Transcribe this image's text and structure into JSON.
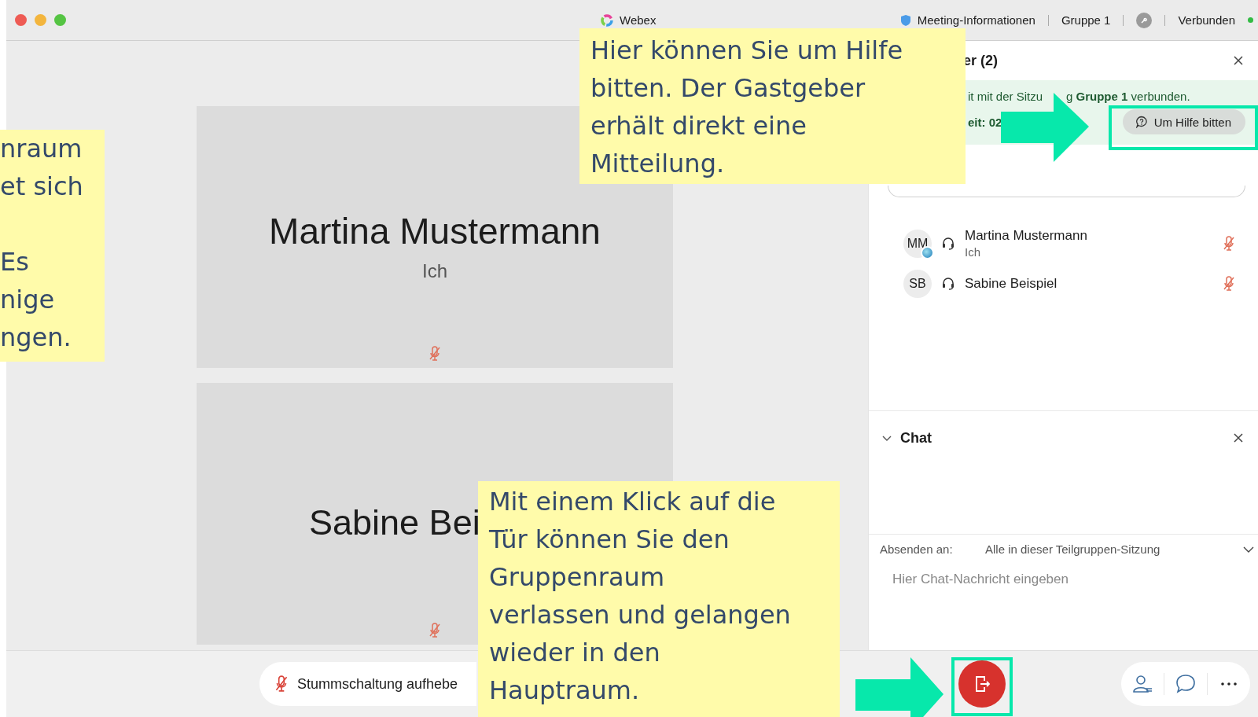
{
  "window": {
    "title": "Webex",
    "meeting_info": "Meeting-Informationen",
    "session": "Gruppe 1",
    "status": "Verbunden",
    "connected": true
  },
  "video_tiles": [
    {
      "name": "Martina Mustermann",
      "subtitle": "Ich",
      "muted": true
    },
    {
      "name": "Sabine Bei",
      "muted": true
    }
  ],
  "participants_panel": {
    "title": "er (2)",
    "banner": {
      "line_1_start": "it mit der Sitzu",
      "line_1_end": "g **Gruppe 1** verbunden.",
      "line_2": "eit: 02"
    },
    "help_button": "Um Hilfe bitten",
    "participants": [
      {
        "initials": "MM",
        "name": "Martina Mustermann",
        "subtitle": "Ich",
        "muted": true,
        "presence": true
      },
      {
        "initials": "SB",
        "name": "Sabine Beispiel",
        "muted": true,
        "presence": false
      }
    ]
  },
  "chat": {
    "title": "Chat",
    "expanded": true,
    "send_to_label": "Absenden an:",
    "send_to_value": "Alle in dieser Teilgruppen-Sitzung",
    "message": {
      "placeholder": "Hier Chat-Nachricht eingeben"
    }
  },
  "controls": {
    "unmute_button": "Stummschaltung aufhebe"
  },
  "callouts": [
    {
      "paragraphs": [
        [
          "nraum",
          "et sich"
        ],
        [
          "Es",
          "nige",
          "ngen."
        ]
      ]
    },
    {
      "paragraphs": [
        [
          "Hier können Sie um Hilfe",
          "bitten. Der Gastgeber",
          "erhält direkt eine",
          "Mitteilung."
        ]
      ]
    },
    {
      "paragraphs": [
        [
          "Mit einem Klick auf die",
          "Tür können Sie den",
          "Gruppenraum",
          "verlassen und gelangen",
          "wieder in den",
          "Hauptraum."
        ]
      ]
    }
  ]
}
